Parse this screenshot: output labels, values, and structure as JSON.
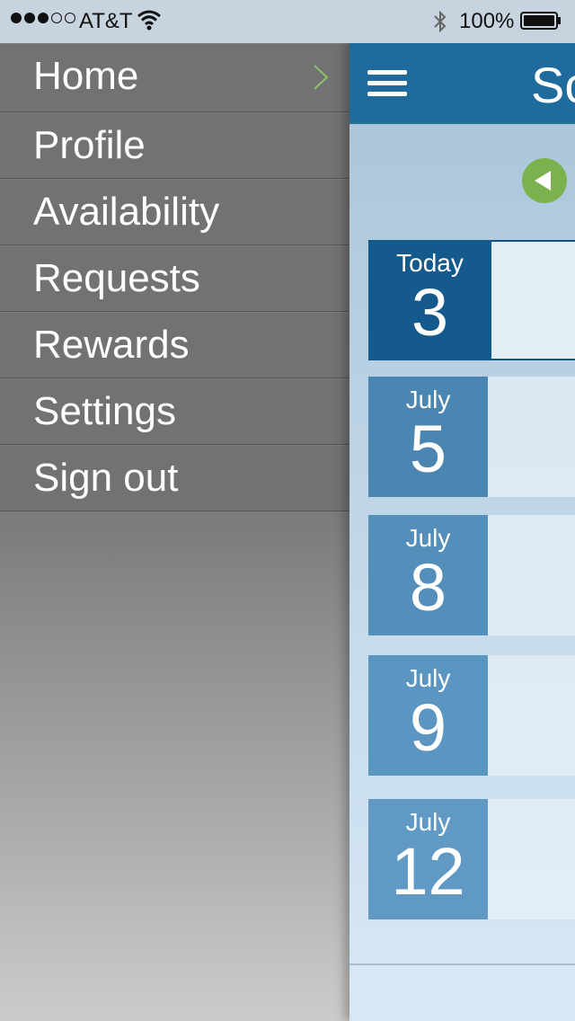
{
  "status": {
    "carrier": "AT&T",
    "battery_pct": "100%",
    "signal_bars_filled": 3,
    "signal_bars_total": 5
  },
  "menu": {
    "items": [
      {
        "label": "Home",
        "active": true
      },
      {
        "label": "Profile"
      },
      {
        "label": "Availability"
      },
      {
        "label": "Requests"
      },
      {
        "label": "Rewards"
      },
      {
        "label": "Settings"
      },
      {
        "label": "Sign out"
      }
    ]
  },
  "main": {
    "title": "Sc",
    "days": [
      {
        "month": "Today",
        "day": "3",
        "color": "#155a8d"
      },
      {
        "month": "July",
        "day": "5",
        "color": "#4b85b2"
      },
      {
        "month": "July",
        "day": "8",
        "color": "#548ebb"
      },
      {
        "month": "July",
        "day": "9",
        "color": "#5b95c2"
      },
      {
        "month": "July",
        "day": "12",
        "color": "#5f99c4"
      }
    ]
  },
  "colors": {
    "nav_bar": "#1f6b9e",
    "accent_green": "#7cb24d",
    "menu_bg": "#727272"
  }
}
